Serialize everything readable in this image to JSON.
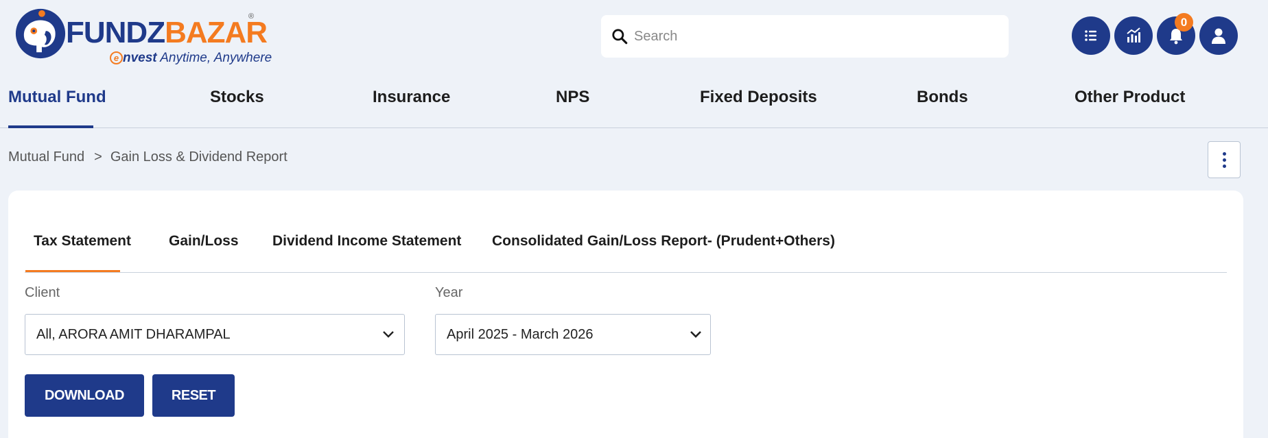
{
  "header": {
    "logo": {
      "brand_left": "FUNDZ",
      "brand_right": "BAZAR",
      "registered_mark": "®",
      "tagline_e": "e",
      "tagline_brand": "nvest",
      "tagline_rest": " Anytime, Anywhere"
    },
    "search": {
      "placeholder": "Search",
      "icon": "search-icon"
    },
    "icons": [
      {
        "name": "list-icon"
      },
      {
        "name": "chart-icon"
      },
      {
        "name": "bell-icon",
        "badge": "0"
      },
      {
        "name": "user-icon"
      }
    ]
  },
  "nav": {
    "items": [
      {
        "label": "Mutual Fund",
        "active": true
      },
      {
        "label": "Stocks"
      },
      {
        "label": "Insurance"
      },
      {
        "label": "NPS"
      },
      {
        "label": "Fixed Deposits"
      },
      {
        "label": "Bonds"
      },
      {
        "label": "Other Product"
      }
    ]
  },
  "breadcrumb": {
    "root": "Mutual Fund",
    "separator": ">",
    "current": "Gain Loss & Dividend Report"
  },
  "report": {
    "tabs": [
      {
        "label": "Tax Statement",
        "active": true
      },
      {
        "label": "Gain/Loss"
      },
      {
        "label": "Dividend Income Statement"
      },
      {
        "label": "Consolidated Gain/Loss Report- (Prudent+Others)"
      }
    ],
    "client": {
      "label": "Client",
      "value": "All, ARORA AMIT DHARAMPAL"
    },
    "year": {
      "label": "Year",
      "value": "April 2025 - March 2026"
    },
    "buttons": {
      "download": "DOWNLOAD",
      "reset": "RESET"
    }
  },
  "colors": {
    "brand_blue": "#1f3a8a",
    "brand_orange": "#f47b20",
    "page_bg": "#eef2f8"
  }
}
